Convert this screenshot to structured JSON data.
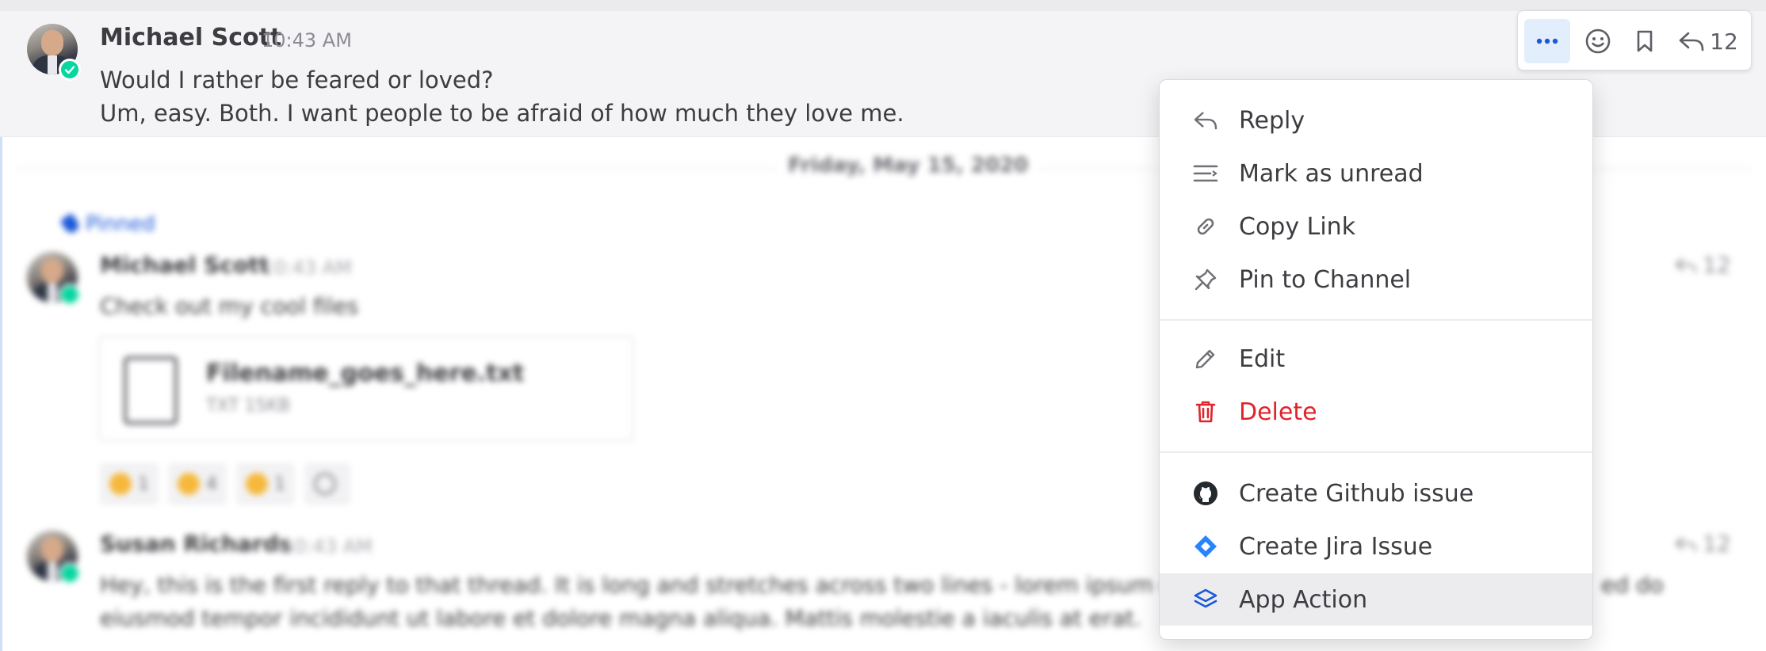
{
  "post": {
    "author": "Michael Scott",
    "time": "10:43 AM",
    "lines": [
      "Would I rather be feared or loved?",
      "Um, easy. Both. I want people to be afraid of how much they love me."
    ]
  },
  "toolbar": {
    "more_icon": "more-dots-icon",
    "reaction_icon": "emoji-icon",
    "save_icon": "bookmark-icon",
    "reply_icon": "reply-icon",
    "reply_count": "12"
  },
  "menu": {
    "items": [
      {
        "label": "Reply",
        "icon": "reply-icon"
      },
      {
        "label": "Mark as unread",
        "icon": "mark-unread-icon"
      },
      {
        "label": "Copy Link",
        "icon": "link-icon"
      },
      {
        "label": "Pin to Channel",
        "icon": "pin-icon"
      },
      {
        "label": "Edit",
        "icon": "pencil-icon"
      },
      {
        "label": "Delete",
        "icon": "trash-icon"
      },
      {
        "label": "Create Github issue",
        "icon": "github-icon"
      },
      {
        "label": "Create Jira Issue",
        "icon": "jira-icon"
      },
      {
        "label": "App Action",
        "icon": "app-stack-icon"
      }
    ],
    "danger_color": "#e0242b",
    "highlighted_item": "App Action"
  },
  "background": {
    "date_separator": "Friday, May 15, 2020",
    "pinned_label": "Pinned",
    "post1": {
      "author": "Michael Scott",
      "time": "10:43 AM",
      "text": "Check out my cool files",
      "reply_count": "12",
      "file": {
        "name": "Filename_goes_here.txt",
        "meta": "TXT 15KB"
      },
      "reactions": [
        {
          "icon": "thumbs-up-emoji",
          "count": "1"
        },
        {
          "icon": "clap-emoji",
          "count": "4"
        },
        {
          "icon": "ok-hand-emoji",
          "count": "1"
        }
      ]
    },
    "post2": {
      "author": "Susan Richards",
      "time": "10:43 AM",
      "text_line1": "Hey, this is the first reply to that thread. It is long and stretches across two lines - lorem ipsum dol",
      "text_line1_tail": "ed do",
      "text_line2": "eiusmod tempor incididunt ut labore et dolore magna aliqua. Mattis molestie a iaculis at erat.",
      "reply_count": "12"
    }
  },
  "colors": {
    "accent": "#1c58d9",
    "online": "#06d6a0",
    "hover_bg": "#e3eefc"
  }
}
